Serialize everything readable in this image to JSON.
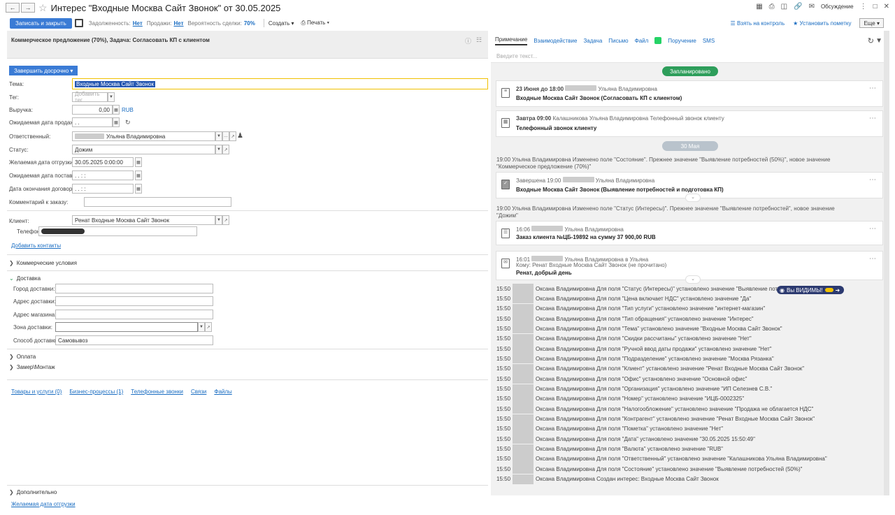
{
  "window": {
    "title": "Интерес \"Входные Москва Сайт Звонок\" от 30.05.2025",
    "discussion_label": "Обсуждение"
  },
  "toolbar": {
    "save_close": "Записать и закрыть",
    "debt_label": "Задолженность:",
    "debt_value": "Нет",
    "sales_label": "Продажи:",
    "sales_value": "Нет",
    "probability_label": "Вероятность сделки:",
    "probability_value": "70%",
    "create": "Создать",
    "print": "Печать",
    "take_control": "Взять на контроль",
    "set_mark": "Установить пометку",
    "more": "Еще"
  },
  "info_bar": {
    "text": "Коммерческое предложение  (70%), Задача: Согласовать КП с клиентом"
  },
  "form": {
    "finish_early": "Завершить досрочно",
    "topic_label": "Тема:",
    "topic_value": "Входные Москва Сайт Звонок",
    "tag_label": "Тег:",
    "tag_placeholder": "Добавить тег",
    "revenue_label": "Выручка:",
    "revenue_value": "0,00",
    "revenue_currency": "RUB",
    "exp_sale_date_label": "Ожидаемая дата продажи:",
    "exp_sale_date_value": " .  .",
    "responsible_label": "Ответственный:",
    "responsible_value": "Ульяна Владимировна",
    "status_label": "Статус:",
    "status_value": "Дожим",
    "ship_date_label": "Желаемая дата отгрузки:",
    "ship_date_value": "30.05.2025  0:00:00",
    "delivery_date_label": "Ожидаемая дата поставки:",
    "delivery_date_value": " .  .       :   :",
    "contract_end_label": "Дата окончания договора:",
    "contract_end_value": " .  .       :   :",
    "order_comment_label": "Комментарий к заказу:",
    "client_label": "Клиент:",
    "client_value": "Ренат Входные Москва Сайт Звонок",
    "phone_label": "Телефон:",
    "add_contacts": "Добавить контакты"
  },
  "sections": {
    "commercial": "Коммерческие условия",
    "delivery": "Доставка",
    "city_label": "Город доставки:",
    "address_label": "Адрес доставки:",
    "shop_address_label": "Адрес магазина:",
    "zone_label": "Зона доставки:",
    "method_label": "Способ доставки:",
    "method_value": "Самовывоз",
    "payment": "Оплата",
    "measure": "Замер\\Монтаж",
    "additional": "Дополнительно",
    "ship_date_link": "Желаемая дата отгрузки"
  },
  "bottom_tabs": [
    "Товары и услуги (0)",
    "Бизнес-процессы (1)",
    "Телефонные звонки",
    "Связи",
    "Файлы"
  ],
  "right": {
    "tabs": [
      "Примечание",
      "Взаимодействие",
      "Задача",
      "Письмо",
      "Файл",
      "Поручение",
      "SMS"
    ],
    "input_placeholder": "Введите текст...",
    "planned": "Запланировано",
    "date_may30": "30 Мая",
    "card1_meta_date": "23 Июня до 18:00",
    "card1_meta_name": "Ульяна Владимировна",
    "card1_subject": "Входные Москва Сайт Звонок (Согласовать КП с клиентом)",
    "card2_meta_date": "Завтра 09:00",
    "card2_meta_name": "Калашникова Ульяна Владимировна Телефонный звонок клиенту",
    "card2_subject": "Телефонный звонок клиенту",
    "hist1_line1": "19:00                     Ульяна Владимировна Изменено поле \"Состояние\". Прежнее значение \"Выявление потребностей (50%)\", новое значение",
    "hist1_line2": "\"Коммерческое предложение (70%)\"",
    "card3_meta": "Завершена 19:00",
    "card3_meta_name": "Ульяна Владимировна",
    "card3_subject": "Входные Москва Сайт Звонок (Выявление потребностей и подготовка КП)",
    "hist2_line1": "19:00                     Ульяна Владимировна Изменено поле \"Статус (Интересы)\". Прежнее значение \"Выявление потребностей\", новое значение",
    "hist2_line2": "\"Дожим\"",
    "card4_time": "16:06",
    "card4_name": "Ульяна Владимировна",
    "card4_subject": "Заказ клиента №ЦБ-19892 на сумму 37 900,00 RUB",
    "card5_time": "16:01",
    "card5_name": "Ульяна Владимировна в Ульяна",
    "card5_to": "Кому: Ренат Входные Москва Сайт Звонок (не прочитано)",
    "card5_subject": "Ренат, добрый день",
    "badge": "Вы ВИДИМЫ!",
    "log_time": "15:50",
    "log": [
      "Оксана Владимировна Для поля \"Статус (Интересы)\" установлено значение \"Выявление потребн",
      "Оксана Владимировна Для поля \"Цена включает НДС\" установлено значение \"Да\"",
      "Оксана Владимировна Для поля \"Тип услуги\" установлено значение \"интернет-магазин\"",
      "Оксана Владимировна Для поля \"Тип обращения\" установлено значение \"Интерес\"",
      "Оксана Владимировна Для поля \"Тема\" установлено значение \"Входные Москва Сайт Звонок\"",
      "Оксана Владимировна Для поля \"Скидки рассчитаны\" установлено значение \"Нет\"",
      "Оксана Владимировна Для поля \"Ручной ввод даты продажи\" установлено значение \"Нет\"",
      "Оксана Владимировна Для поля \"Подразделение\" установлено значение \"Москва Рязанка\"",
      "Оксана Владимировна Для поля \"Клиент\" установлено значение \"Ренат Входные Москва Сайт Звонок\"",
      "Оксана Владимировна Для поля \"Офис\" установлено значение \"Основной офис\"",
      "Оксана Владимировна Для поля \"Организация\" установлено значение \"ИП Селезнев С.В.\"",
      "Оксана Владимировна Для поля \"Номер\" установлено значение \"ИЦБ-0002325\"",
      "Оксана Владимировна Для поля \"Налогообложение\" установлено значение \"Продажа не облагается НДС\"",
      "Оксана Владимировна Для поля \"Контрагент\" установлено значение \"Ренат Входные Москва Сайт Звонок\"",
      "Оксана Владимировна Для поля \"Пометка\" установлено значение \"Нет\"",
      "Оксана Владимировна Для поля \"Дата\" установлено значение \"30.05.2025 15:50:49\"",
      "Оксана Владимировна Для поля \"Валюта\" установлено значение \"RUB\"",
      "Оксана Владимировна Для поля \"Ответственный\" установлено значение \"Калашникова Ульяна Владимировна\"",
      "Оксана Владимировна Для поля \"Состояние\" установлено значение \"Выявление потребностей (50%)\"",
      "Оксана Владимировна Создан интерес: Входные Москва Сайт Звонок"
    ]
  },
  "colors": {
    "accent": "#3a7bd5",
    "link": "#1a6dc2",
    "planned_green": "#2e9e5b",
    "date_pill": "#b9c3cc"
  }
}
